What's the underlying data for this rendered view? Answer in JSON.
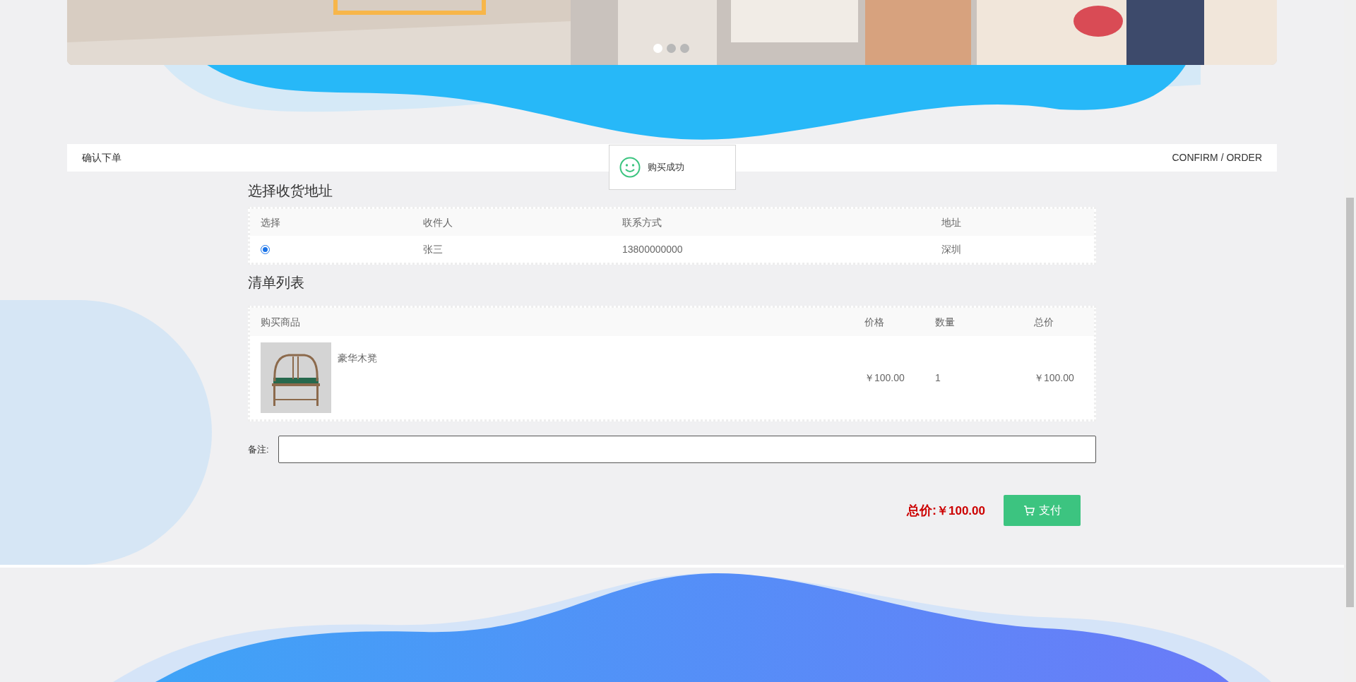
{
  "banner": {
    "dots": [
      {
        "selected": true
      },
      {
        "selected": false
      },
      {
        "selected": false
      }
    ]
  },
  "header": {
    "title": "确认下单",
    "subtitle": "CONFIRM / ORDER"
  },
  "toast": {
    "message": "购买成功"
  },
  "address_section": {
    "title": "选择收货地址",
    "columns": [
      "选择",
      "收件人",
      "联系方式",
      "地址"
    ],
    "rows": [
      {
        "selected": true,
        "recipient": "张三",
        "phone": "13800000000",
        "address": "深圳"
      }
    ]
  },
  "list_section": {
    "title": "清单列表",
    "columns": [
      "购买商品",
      "价格",
      "数量",
      "总价"
    ],
    "rows": [
      {
        "name": "豪华木凳",
        "price": "￥100.00",
        "quantity": "1",
        "total": "￥100.00"
      }
    ]
  },
  "remark": {
    "label": "备注:"
  },
  "summary": {
    "label": "总价:",
    "amount": "￥100.00",
    "pay_button": "支付"
  }
}
